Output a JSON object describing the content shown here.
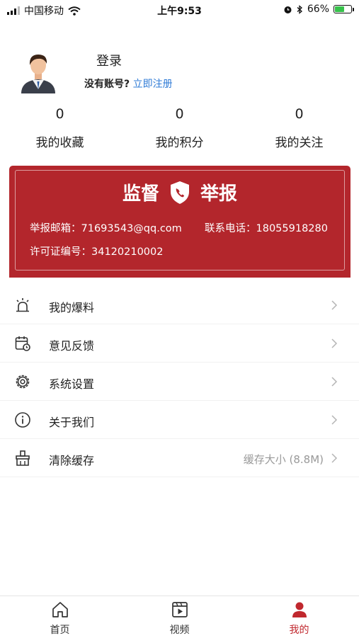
{
  "status_bar": {
    "carrier": "中国移动",
    "time": "上午9:53",
    "battery_percent": "66%",
    "battery_level": 0.66,
    "icons": [
      "signal-icon",
      "wifi-icon",
      "alarm-icon",
      "bluetooth-icon",
      "battery-icon"
    ]
  },
  "profile": {
    "login_label": "登录",
    "no_account_text": "没有账号?",
    "register_link": "立即注册"
  },
  "stats": [
    {
      "value": "0",
      "label": "我的收藏"
    },
    {
      "value": "0",
      "label": "我的积分"
    },
    {
      "value": "0",
      "label": "我的关注"
    }
  ],
  "report": {
    "title_left": "监督",
    "title_right": "举报",
    "email": "举报邮箱：71693543@qq.com",
    "phone": "联系电话：18055918280",
    "license": "许可证编号：34120210002",
    "color": "#b3262c"
  },
  "menu": [
    {
      "label": "我的爆料",
      "icon": "alarm-light-icon"
    },
    {
      "label": "意见反馈",
      "icon": "calendar-feedback-icon"
    },
    {
      "label": "系统设置",
      "icon": "gear-icon"
    },
    {
      "label": "关于我们",
      "icon": "info-icon"
    },
    {
      "label": "清除缓存",
      "icon": "broom-icon",
      "extra": "缓存大小 (8.8M)"
    }
  ],
  "tabs": [
    {
      "label": "首页",
      "icon": "home-icon",
      "active": false
    },
    {
      "label": "视频",
      "icon": "video-icon",
      "active": false
    },
    {
      "label": "我的",
      "icon": "user-icon",
      "active": true
    }
  ],
  "colors": {
    "accent": "#c0282e",
    "link": "#2f7bd6"
  }
}
